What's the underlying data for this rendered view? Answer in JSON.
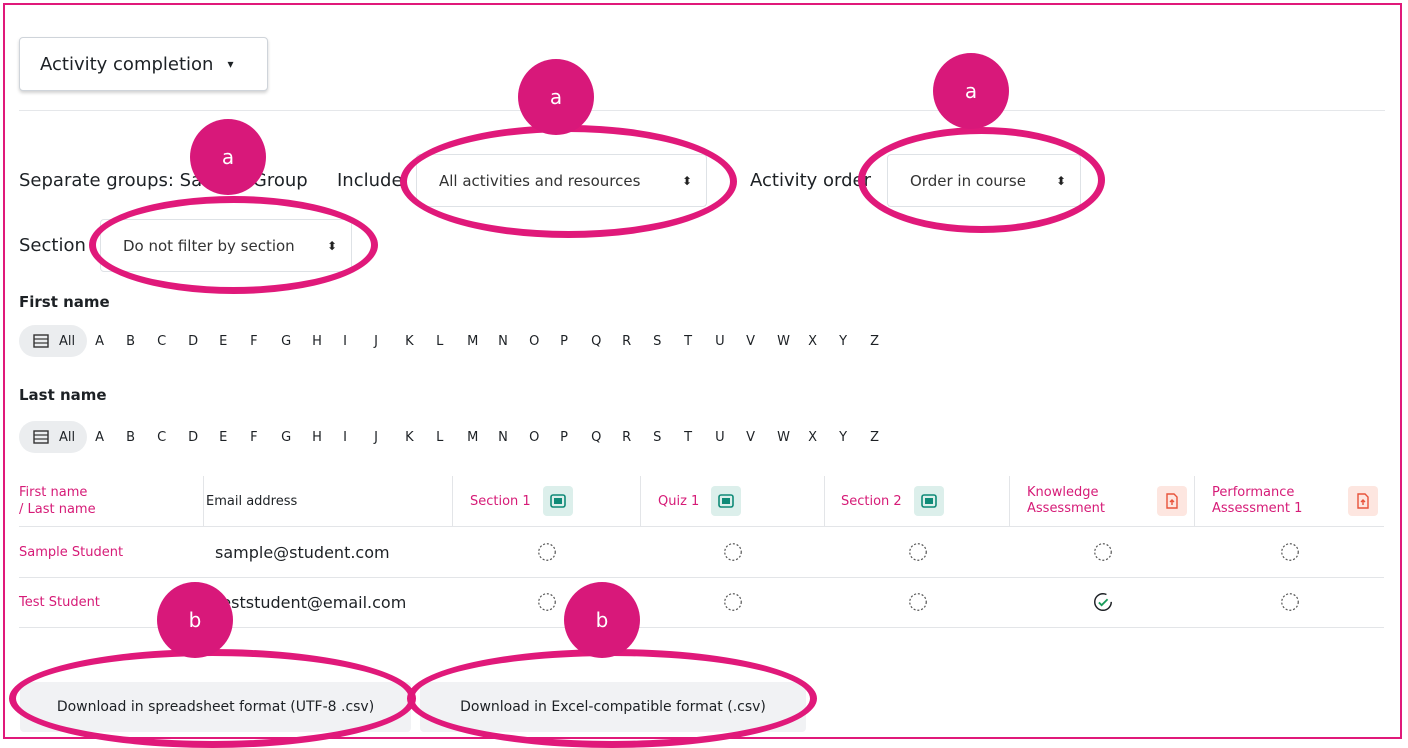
{
  "report_selector": {
    "label": "Activity completion"
  },
  "filters": {
    "groups_label": "Separate groups: Sample Group",
    "include_label": "Include",
    "include_value": "All activities and resources",
    "order_label": "Activity order",
    "order_value": "Order in course",
    "section_label": "Section",
    "section_value": "Do not filter by section"
  },
  "first_name": {
    "label": "First name",
    "all": "All"
  },
  "last_name": {
    "label": "Last name",
    "all": "All"
  },
  "letters": [
    "A",
    "B",
    "C",
    "D",
    "E",
    "F",
    "G",
    "H",
    "I",
    "J",
    "K",
    "L",
    "M",
    "N",
    "O",
    "P",
    "Q",
    "R",
    "S",
    "T",
    "U",
    "V",
    "W",
    "X",
    "Y",
    "Z"
  ],
  "table": {
    "header_name_first": "First name",
    "header_name_last": "/ Last name",
    "header_email": "Email address",
    "activities": [
      {
        "name": "Section 1",
        "icon": "page-icon",
        "color": "#0f8a77"
      },
      {
        "name": "Quiz 1",
        "icon": "page-icon",
        "color": "#0f8a77"
      },
      {
        "name": "Section 2",
        "icon": "page-icon",
        "color": "#0f8a77"
      },
      {
        "name_line1": "Knowledge",
        "name_line2": "Assessment",
        "icon": "assignment-upload-icon",
        "color": "#e8533a"
      },
      {
        "name_line1": "Performance",
        "name_line2": "Assessment 1",
        "icon": "assignment-upload-icon",
        "color": "#e8533a"
      }
    ],
    "rows": [
      {
        "name": "Sample Student",
        "email": "sample@student.com",
        "status": [
          "incomplete",
          "incomplete",
          "incomplete",
          "incomplete",
          "incomplete"
        ]
      },
      {
        "name": "Test Student",
        "email": "teststudent@email.com",
        "status": [
          "incomplete",
          "incomplete",
          "incomplete",
          "complete",
          "incomplete"
        ]
      }
    ]
  },
  "downloads": {
    "spreadsheet": "Download in spreadsheet format (UTF-8 .csv)",
    "excel": "Download in Excel-compatible format (.csv)"
  },
  "callouts": {
    "a": "a",
    "b": "b"
  },
  "colors": {
    "accent": "#e0197a",
    "link": "#d61b77"
  }
}
